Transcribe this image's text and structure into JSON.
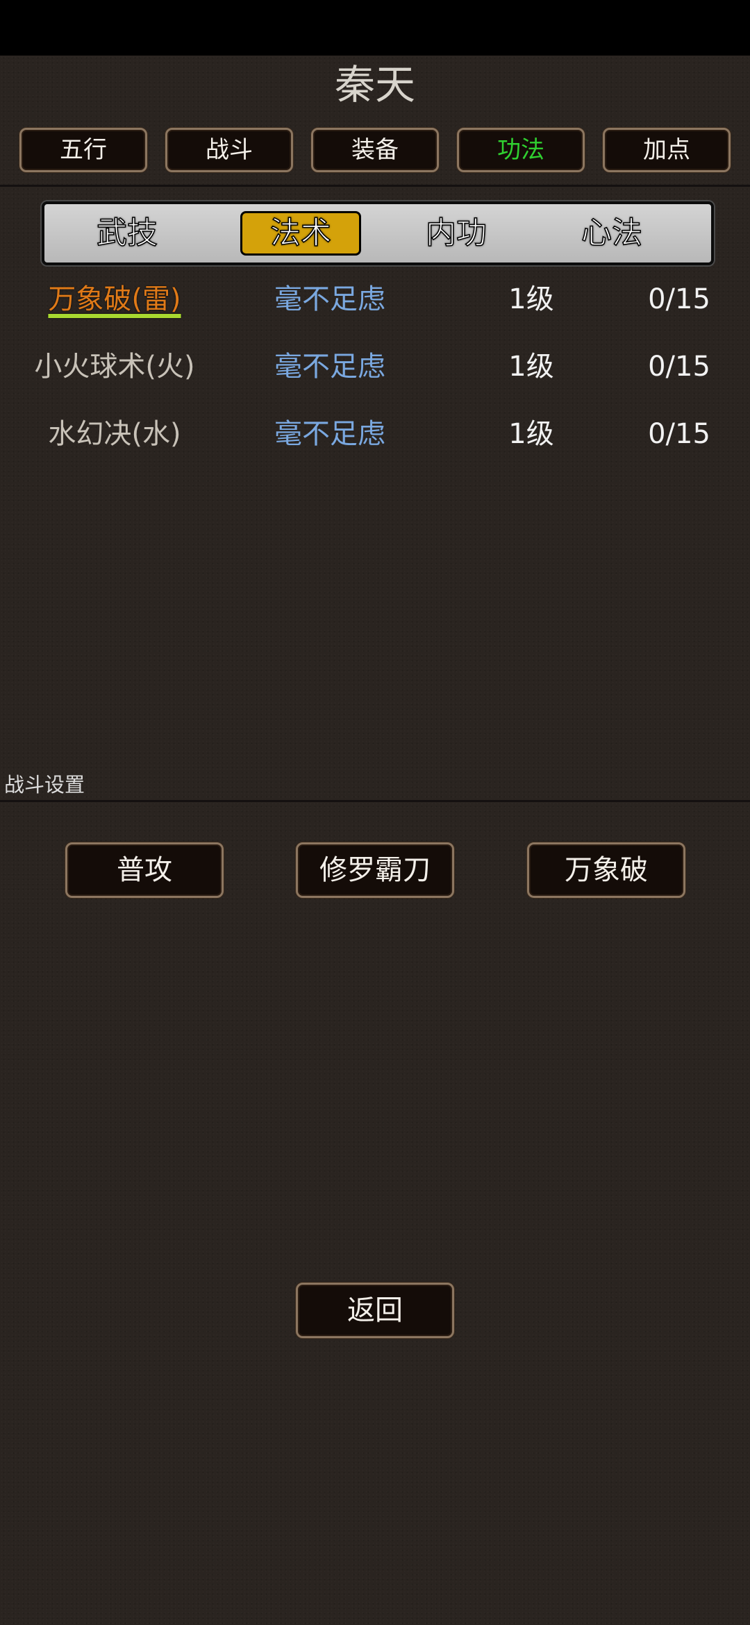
{
  "title": "秦天",
  "nav_tabs": [
    {
      "label": "五行"
    },
    {
      "label": "战斗"
    },
    {
      "label": "装备"
    },
    {
      "label": "功法"
    },
    {
      "label": "加点"
    }
  ],
  "active_nav_tab": "功法",
  "sub_tabs": [
    {
      "label": "武技"
    },
    {
      "label": "法术"
    },
    {
      "label": "内功"
    },
    {
      "label": "心法"
    }
  ],
  "active_sub_tab": "法术",
  "skills": [
    {
      "name": "万象破(雷)",
      "rank": "毫不足虑",
      "level": "1级",
      "progress": "0/15"
    },
    {
      "name": "小火球术(火)",
      "rank": "毫不足虑",
      "level": "1级",
      "progress": "0/15"
    },
    {
      "name": "水幻决(水)",
      "rank": "毫不足虑",
      "level": "1级",
      "progress": "0/15"
    }
  ],
  "battle_settings": {
    "label": "战斗设置",
    "slots": [
      "普攻",
      "修罗霸刀",
      "万象破"
    ]
  },
  "return_label": "返回",
  "colors": {
    "active_nav": "#30d030",
    "active_subtab": "#d4a20a",
    "selected_skill": "#e07a18",
    "rank_text": "#7aa8e0"
  }
}
